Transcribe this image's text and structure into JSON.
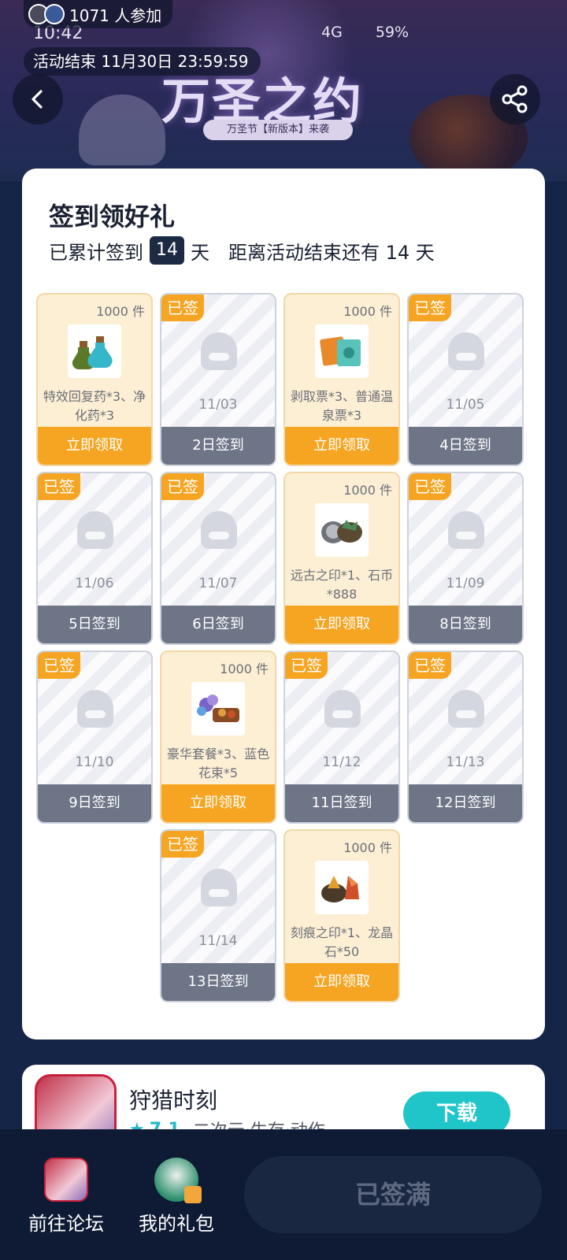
{
  "status_bar": {
    "time": "10:42",
    "battery": "59%",
    "network": "4G"
  },
  "header": {
    "participants": "1071 人参加",
    "end_time": "活动结束 11月30日 23:59:59",
    "title": "万圣之约",
    "subtitle": "万圣节【新版本】来袭",
    "back_icon": "chevron-left-icon",
    "share_icon": "share-icon"
  },
  "checkin": {
    "title": "签到领好礼",
    "stat_prefix": "已累计签到",
    "days": "14",
    "stat_unit": "天",
    "remaining": "距离活动结束还有 14 天",
    "signed_tag": "已签",
    "cells": [
      {
        "type": "reward",
        "qty": "1000 件",
        "item": "特效回复药*3、净化药*3",
        "button": "立即领取",
        "icon": "potion-icon"
      },
      {
        "type": "signed",
        "date": "11/03",
        "button": "2日签到"
      },
      {
        "type": "reward",
        "qty": "1000 件",
        "item": "剥取票*3、普通温泉票*3",
        "button": "立即领取",
        "icon": "ticket-icon"
      },
      {
        "type": "signed",
        "date": "11/05",
        "button": "4日签到"
      },
      {
        "type": "signed",
        "date": "11/06",
        "button": "5日签到"
      },
      {
        "type": "signed",
        "date": "11/07",
        "button": "6日签到"
      },
      {
        "type": "reward",
        "qty": "1000 件",
        "item": "远古之印*1、石币*888",
        "button": "立即领取",
        "icon": "coin-icon"
      },
      {
        "type": "signed",
        "date": "11/09",
        "button": "8日签到"
      },
      {
        "type": "signed",
        "date": "11/10",
        "button": "9日签到"
      },
      {
        "type": "reward",
        "qty": "1000 件",
        "item": "豪华套餐*3、蓝色花束*5",
        "button": "立即领取",
        "icon": "meal-icon"
      },
      {
        "type": "signed",
        "date": "11/12",
        "button": "11日签到"
      },
      {
        "type": "signed",
        "date": "11/13",
        "button": "12日签到"
      },
      {
        "type": "signed",
        "date": "11/14",
        "button": "13日签到"
      },
      {
        "type": "reward",
        "qty": "1000 件",
        "item": "刻痕之印*1、龙晶石*50",
        "button": "立即领取",
        "icon": "crystal-icon"
      }
    ]
  },
  "app_card": {
    "name": "狩猎时刻",
    "rating": "7.1",
    "tags": "二次元·生存·动作",
    "download": "下载"
  },
  "bottom_nav": {
    "forum": "前往论坛",
    "gifts": "我的礼包",
    "status_button": "已签满"
  },
  "colors": {
    "accent": "#f6a523",
    "dark": "#152547",
    "teal": "#1fc5c9"
  }
}
